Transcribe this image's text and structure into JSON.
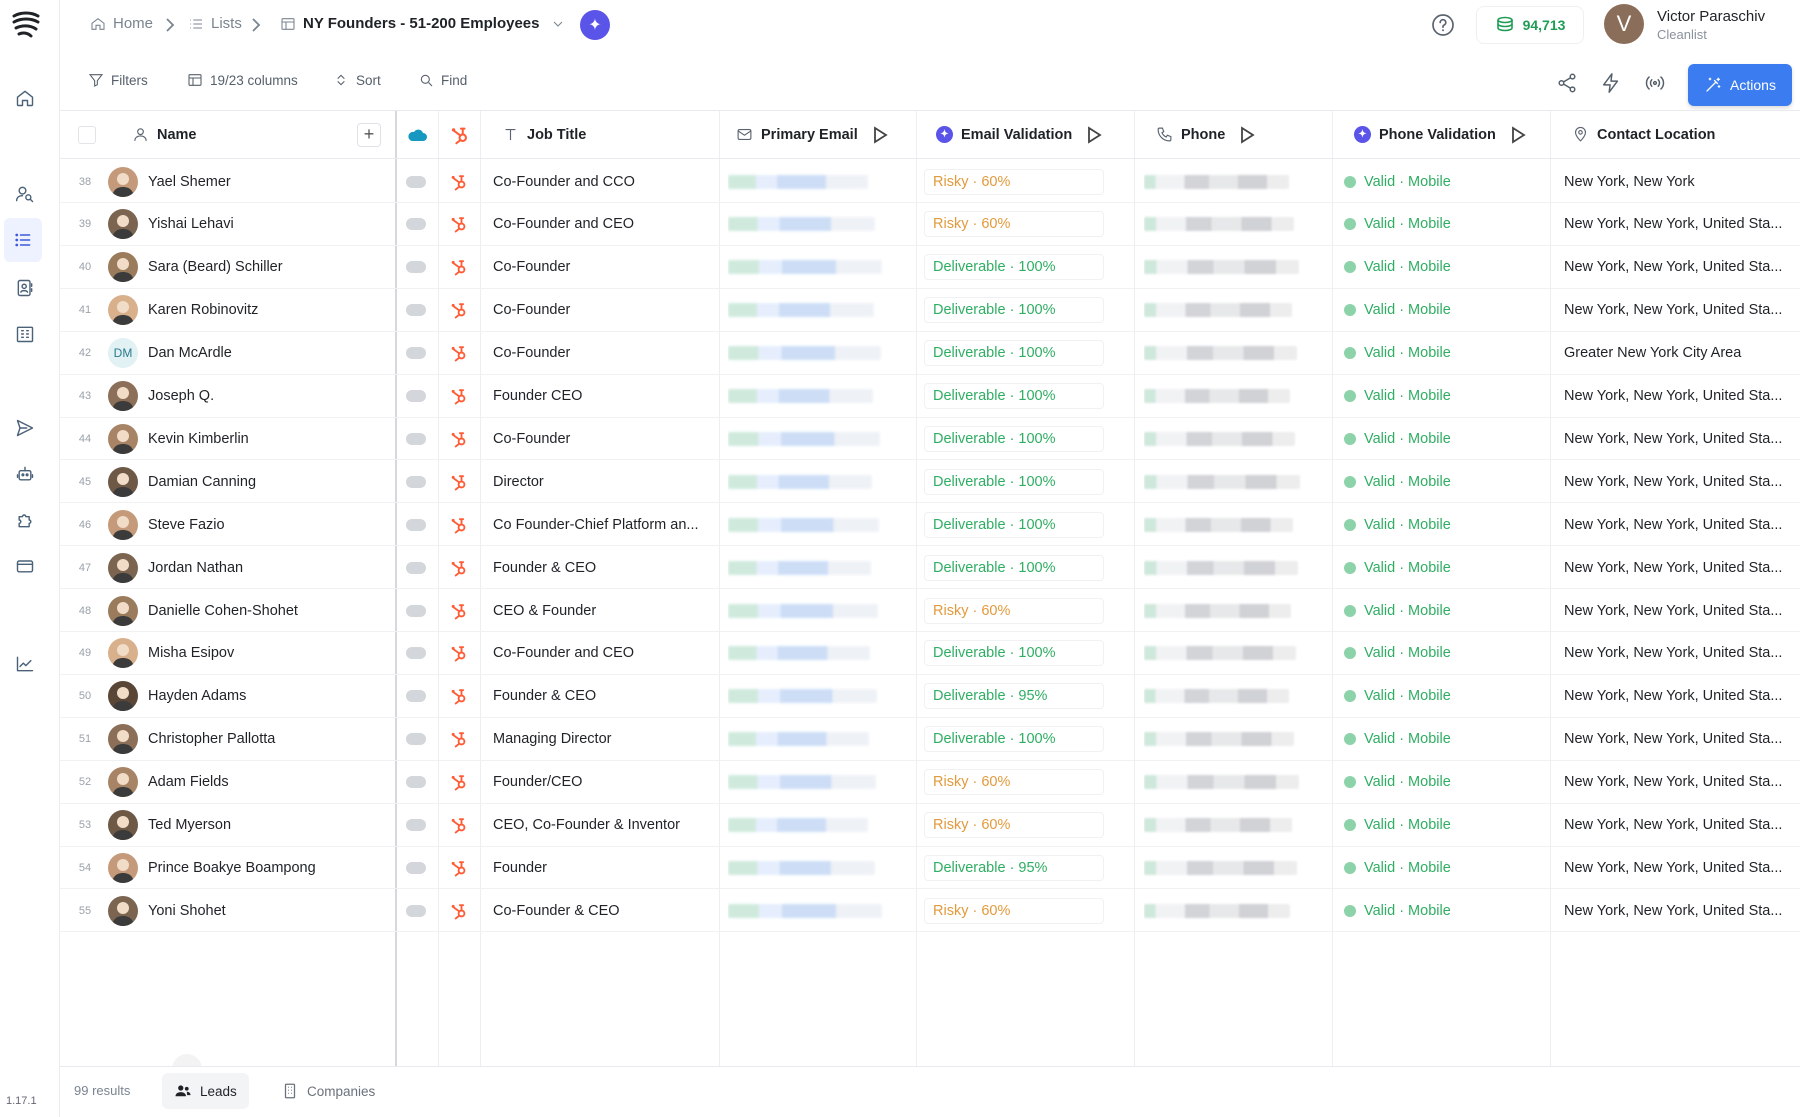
{
  "breadcrumb": {
    "home": "Home",
    "lists": "Lists",
    "current": "NY Founders - 51-200 Employees"
  },
  "credits": "94,713",
  "user": {
    "name": "Victor Paraschiv",
    "org": "Cleanlist",
    "initial": "V"
  },
  "version": "1.17.1",
  "toolbar": {
    "filters": "Filters",
    "columns": "19/23 columns",
    "sort": "Sort",
    "find": "Find",
    "actions": "Actions"
  },
  "columns": {
    "name": "Name",
    "job_title": "Job Title",
    "primary_email": "Primary Email",
    "email_validation": "Email Validation",
    "phone": "Phone",
    "phone_validation": "Phone Validation",
    "contact_location": "Contact Location"
  },
  "rows": [
    {
      "n": "38",
      "name": "Yael Shemer",
      "title": "Co-Founder and CCO",
      "email_val": "Risky · 60%",
      "status": "risky",
      "phone_val": "Valid · Mobile",
      "loc": "New York, New York"
    },
    {
      "n": "39",
      "name": "Yishai Lehavi",
      "title": "Co-Founder and CEO",
      "email_val": "Risky · 60%",
      "status": "risky",
      "phone_val": "Valid · Mobile",
      "loc": "New York, New York, United Sta..."
    },
    {
      "n": "40",
      "name": "Sara (Beard) Schiller",
      "title": "Co-Founder",
      "email_val": "Deliverable · 100%",
      "status": "deliv",
      "phone_val": "Valid · Mobile",
      "loc": "New York, New York, United Sta..."
    },
    {
      "n": "41",
      "name": "Karen Robinovitz",
      "title": "Co-Founder",
      "email_val": "Deliverable · 100%",
      "status": "deliv",
      "phone_val": "Valid · Mobile",
      "loc": "New York, New York, United Sta..."
    },
    {
      "n": "42",
      "name": "Dan McArdle",
      "initials": "DM",
      "title": "Co-Founder",
      "email_val": "Deliverable · 100%",
      "status": "deliv",
      "phone_val": "Valid · Mobile",
      "loc": "Greater New York City Area"
    },
    {
      "n": "43",
      "name": "Joseph Q.",
      "title": "Founder CEO",
      "email_val": "Deliverable · 100%",
      "status": "deliv",
      "phone_val": "Valid · Mobile",
      "loc": "New York, New York, United Sta..."
    },
    {
      "n": "44",
      "name": "Kevin Kimberlin",
      "title": "Co-Founder",
      "email_val": "Deliverable · 100%",
      "status": "deliv",
      "phone_val": "Valid · Mobile",
      "loc": "New York, New York, United Sta..."
    },
    {
      "n": "45",
      "name": "Damian Canning",
      "title": "Director",
      "email_val": "Deliverable · 100%",
      "status": "deliv",
      "phone_val": "Valid · Mobile",
      "loc": "New York, New York, United Sta..."
    },
    {
      "n": "46",
      "name": "Steve Fazio",
      "title": "Co Founder-Chief Platform an...",
      "email_val": "Deliverable · 100%",
      "status": "deliv",
      "phone_val": "Valid · Mobile",
      "loc": "New York, New York, United Sta..."
    },
    {
      "n": "47",
      "name": "Jordan Nathan",
      "title": "Founder & CEO",
      "email_val": "Deliverable · 100%",
      "status": "deliv",
      "phone_val": "Valid · Mobile",
      "loc": "New York, New York, United Sta..."
    },
    {
      "n": "48",
      "name": "Danielle Cohen-Shohet",
      "title": "CEO & Founder",
      "email_val": "Risky · 60%",
      "status": "risky",
      "phone_val": "Valid · Mobile",
      "loc": "New York, New York, United Sta..."
    },
    {
      "n": "49",
      "name": "Misha Esipov",
      "title": "Co-Founder and CEO",
      "email_val": "Deliverable · 100%",
      "status": "deliv",
      "phone_val": "Valid · Mobile",
      "loc": "New York, New York, United Sta..."
    },
    {
      "n": "50",
      "name": "Hayden Adams",
      "title": "Founder & CEO",
      "email_val": "Deliverable · 95%",
      "status": "deliv",
      "phone_val": "Valid · Mobile",
      "loc": "New York, New York, United Sta..."
    },
    {
      "n": "51",
      "name": "Christopher Pallotta",
      "title": "Managing Director",
      "email_val": "Deliverable · 100%",
      "status": "deliv",
      "phone_val": "Valid · Mobile",
      "loc": "New York, New York, United Sta..."
    },
    {
      "n": "52",
      "name": "Adam Fields",
      "title": "Founder/CEO",
      "email_val": "Risky · 60%",
      "status": "risky",
      "phone_val": "Valid · Mobile",
      "loc": "New York, New York, United Sta..."
    },
    {
      "n": "53",
      "name": "Ted Myerson",
      "title": "CEO, Co-Founder & Inventor",
      "email_val": "Risky · 60%",
      "status": "risky",
      "phone_val": "Valid · Mobile",
      "loc": "New York, New York, United Sta..."
    },
    {
      "n": "54",
      "name": "Prince Boakye Boampong",
      "title": "Founder",
      "email_val": "Deliverable · 95%",
      "status": "deliv",
      "phone_val": "Valid · Mobile",
      "loc": "New York, New York, United Sta..."
    },
    {
      "n": "55",
      "name": "Yoni Shohet",
      "title": "Co-Founder & CEO",
      "email_val": "Risky · 60%",
      "status": "risky",
      "phone_val": "Valid · Mobile",
      "loc": "New York, New York, United Sta..."
    }
  ],
  "footer": {
    "results": "99 results",
    "tab_leads": "Leads",
    "tab_companies": "Companies"
  }
}
